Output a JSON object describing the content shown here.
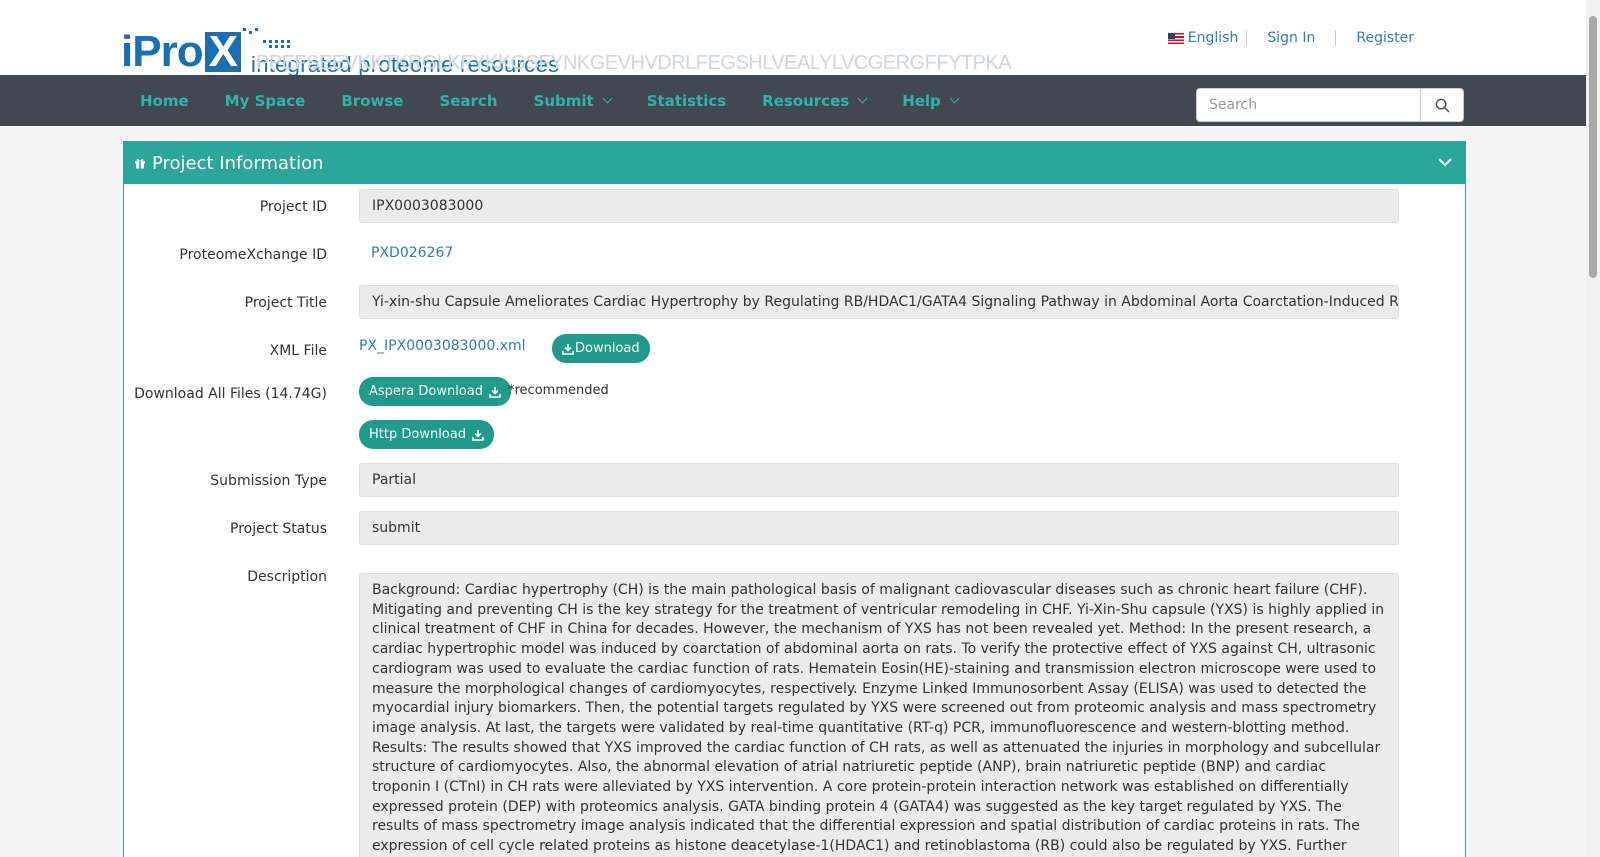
{
  "header": {
    "logo_text": "iPro",
    "logo_x": "X",
    "tagline": "integrated proteome resources",
    "sequence": "PPEFSEEVKKTKRGLKFYKKGSFYNKGEVHVDRLFEGSHLVEALYLVCGERGFFYTPKA",
    "lang_label": "English",
    "signin_label": "Sign In",
    "register_label": "Register"
  },
  "nav": {
    "items": [
      {
        "label": "Home",
        "dropdown": false
      },
      {
        "label": "My Space",
        "dropdown": false
      },
      {
        "label": "Browse",
        "dropdown": false
      },
      {
        "label": "Search",
        "dropdown": false
      },
      {
        "label": "Submit",
        "dropdown": true
      },
      {
        "label": "Statistics",
        "dropdown": false
      },
      {
        "label": "Resources",
        "dropdown": true
      },
      {
        "label": "Help",
        "dropdown": true
      }
    ],
    "search_placeholder": "Search"
  },
  "panel": {
    "title": "Project Information",
    "accent_color": "#2aa69b"
  },
  "project": {
    "id_label": "Project ID",
    "id_value": "IPX0003083000",
    "pxid_label": "ProteomeXchange ID",
    "pxid_value": "PXD026267",
    "title_label": "Project Title",
    "title_value": "Yi-xin-shu Capsule Ameliorates Cardiac Hypertrophy by Regulating RB/HDAC1/GATA4 Signaling Pathway in Abdominal Aorta Coarctation-Induced Rat Model",
    "xml_label": "XML File",
    "xml_value": "PX_IPX0003083000.xml",
    "xml_download_label": "Download",
    "download_all_label": "Download All Files (14.74G)",
    "aspera_label": "Aspera Download",
    "recommended_label": "*recommended",
    "http_label": "Http Download",
    "submission_type_label": "Submission Type",
    "submission_type_value": "Partial",
    "status_label": "Project Status",
    "status_value": "submit",
    "description_label": "Description",
    "description_value": "Background: Cardiac hypertrophy (CH) is the main pathological basis of malignant cadiovascular diseases such as chronic heart failure (CHF). Mitigating and preventing CH is the key strategy for the treatment of ventricular remodeling in CHF. Yi-Xin-Shu capsule (YXS) is highly applied in clinical treatment of CHF in China for decades. However, the mechanism of YXS has not been revealed yet. Method:   In the present research, a cardiac hypertrophic model was induced by coarctation of abdominal aorta on rats. To verify the protective effect of YXS against CH, ultrasonic cardiogram was used to evaluate the cardiac function of rats. Hematein Eosin(HE)-staining and transmission electron microscope were used to measure the morphological changes of cardiomyocytes, respectively. Enzyme Linked Immunosorbent Assay (ELISA) was used to detected the myocardial injury biomarkers. Then, the potential targets regulated by YXS were screened out from proteomic analysis and mass spectrometry image analysis. At last, the targets were validated by real-time quantitative (RT-q) PCR, immunofluorescence and western-blotting method. Results: The results showed that YXS improved the cardiac function of CH rats, as well as attenuated the injuries in morphology and subcellular structure of cardiomyocytes. Also, the abnormal elevation of atrial natriuretic peptide (ANP), brain natriuretic peptide (BNP) and cardiac troponin I (CTnI) in CH rats were alleviated by YXS intervention. A core protein-protein interaction network was established on differentially expressed protein (DEP) with proteomics analysis. GATA binding protein 4 (GATA4) was suggested as the key target regulated by YXS. The results of mass spectrometry image analysis indicated that the differential expression and spatial distribution of cardiac proteins in rats. The expression of cell cycle related proteins as histone deacetylase-1(HDAC1) and retinoblastoma (RB) could also be regulated by YXS. Further validative experiments showed that YXS may attenuate CH by regulating RB/ HDAC1/GATA4 signaling pathway. Moreover, the interaction among the potential active"
  }
}
